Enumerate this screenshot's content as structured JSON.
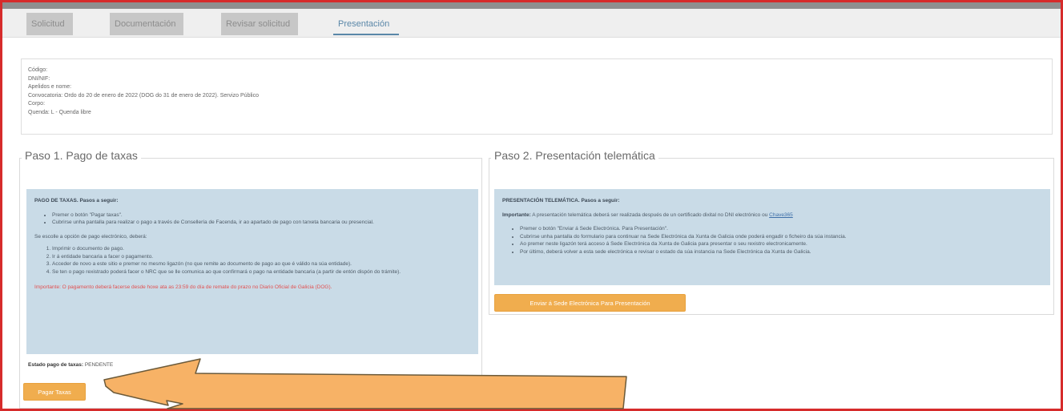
{
  "tabs": [
    {
      "label": "Solicitud"
    },
    {
      "label": "Documentación"
    },
    {
      "label": "Revisar solicitud"
    },
    {
      "label": "Presentación"
    }
  ],
  "info": {
    "lines": [
      "Código:",
      "DNI/NIF:",
      "Apelidos e nome:",
      "Convocatoria: Ordo do 20 de enero de 2022 (DOG do 31 de enero de 2022). Servizo Público",
      "Corpo:",
      "Quenda: L - Quenda libre"
    ]
  },
  "step1": {
    "title": "Paso 1. Pago de taxas",
    "notice_heading": "PAGO DE TAXAS. Pasos a seguir:",
    "bullets": [
      "Premer o botón \"Pagar taxas\".",
      "Cubrirse unha pantalla para realizar o pago a través de Consellería de Facenda, ir ao apartado de pago con tarxeta bancaria ou presencial."
    ],
    "online_heading": "Se escolle a opción de pago electrónico, deberá:",
    "steps": [
      "Imprimir o documento de pago.",
      "Ir á entidade bancaria a facer o pagamento.",
      "Acceder de novo a este sitio e premer no mesmo ligazón (no que remite ao documento de pago ao que é válido na súa entidade).",
      "Se ten o pago rexistrado poderá facer o NRC que se lle comunica ao que confirmará o pago na entidade bancaria (a partir de entón dispón do trámite)."
    ],
    "warning": "Importante: O pagamento deberá facerse desde hoxe ata as 23:59 do día de remate do prazo no Diario Oficial de Galicia (DOG).",
    "status_label": "Estado pago de taxas:",
    "status_value": "PENDENTE",
    "button_label": "Pagar Taxas"
  },
  "step2": {
    "title": "Paso 2. Presentación telemática",
    "notice_heading": "PRESENTACIÓN TELEMÁTICA. Pasos a seguir:",
    "important_label": "Importante:",
    "important_text": "A presentación telemática deberá ser realizada después de un certificado dixital no DNI electrónico ou",
    "important_link": "Chave365",
    "bullets": [
      "Premer o botón \"Enviar á Sede Electrónica. Para Presentación\".",
      "Cubrirse unha pantalla do formulario para continuar na Sede Electrónica da Xunta de Galicia onde poderá engadir o ficheiro da súa instancia.",
      "Ao premer neste ligazón terá acceso á Sede Electrónica da Xunta de Galicia para presentar o seu rexistro electronicamente.",
      "Por último, deberá volver a esta sede electrónica e revisar o estado da súa instancia na Sede Electrónica da Xunta de Galicia."
    ],
    "button_label": "Enviar á Sede Electrónica Para Presentación"
  },
  "colors": {
    "frame": "#d62b2b",
    "accent_button": "#f0ad4e",
    "notice_bg": "#c9dbe7",
    "arrow": "#f7b266",
    "active_tab": "#5a87a8"
  }
}
